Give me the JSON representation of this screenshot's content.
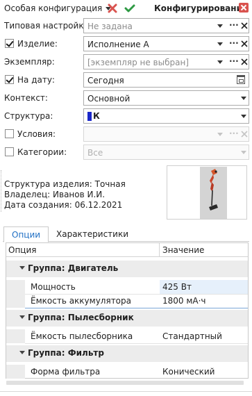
{
  "header": {
    "config_selector": "Особая конфигурация",
    "title": "Конфигурирование",
    "colors": {
      "cancel": "#d9534f",
      "confirm": "#2e9a44",
      "close": "#d9534f"
    }
  },
  "form": {
    "typical_setting": {
      "label": "Типовая настройка:",
      "value": "Не задана"
    },
    "product": {
      "label": "Изделие:",
      "checked": true,
      "value": "Исполнение А"
    },
    "instance": {
      "label": "Экземпляр:",
      "value": "[экземпляр не выбран]"
    },
    "on_date": {
      "label": "На дату:",
      "checked": true,
      "value": "Сегодня"
    },
    "context": {
      "label": "Контекст:",
      "value": "Основной"
    },
    "structure": {
      "label": "Структура:",
      "value": "К",
      "marker_color": "#1a27c9"
    },
    "conditions": {
      "label": "Условия:",
      "checked": false,
      "value": ""
    },
    "categories": {
      "label": "Категории:",
      "checked": false,
      "value": "Все"
    }
  },
  "info": {
    "structure_line": "Структура изделия:  Точная",
    "owner_line": "Владелец:  Иванов И.И.",
    "created_line": "Дата создания:  06.12.2021"
  },
  "tabs": [
    {
      "label": "Опции",
      "active": true
    },
    {
      "label": "Характеристики",
      "active": false
    }
  ],
  "grid": {
    "columns": [
      "Опция",
      "Значение"
    ],
    "groups": [
      {
        "title": "Группа: Двигатель",
        "rows": [
          {
            "name": "Мощность",
            "value": "425 Вт"
          },
          {
            "name": "Ёмкость аккумулятора",
            "value": "1800 мА·ч"
          }
        ]
      },
      {
        "title": "Группа: Пылесборник",
        "rows": [
          {
            "name": "Ёмкость пылесборника",
            "value": "Стандартный"
          }
        ]
      },
      {
        "title": "Группа: Фильтр",
        "rows": [
          {
            "name": "Форма фильтра",
            "value": "Конический"
          }
        ]
      }
    ]
  }
}
